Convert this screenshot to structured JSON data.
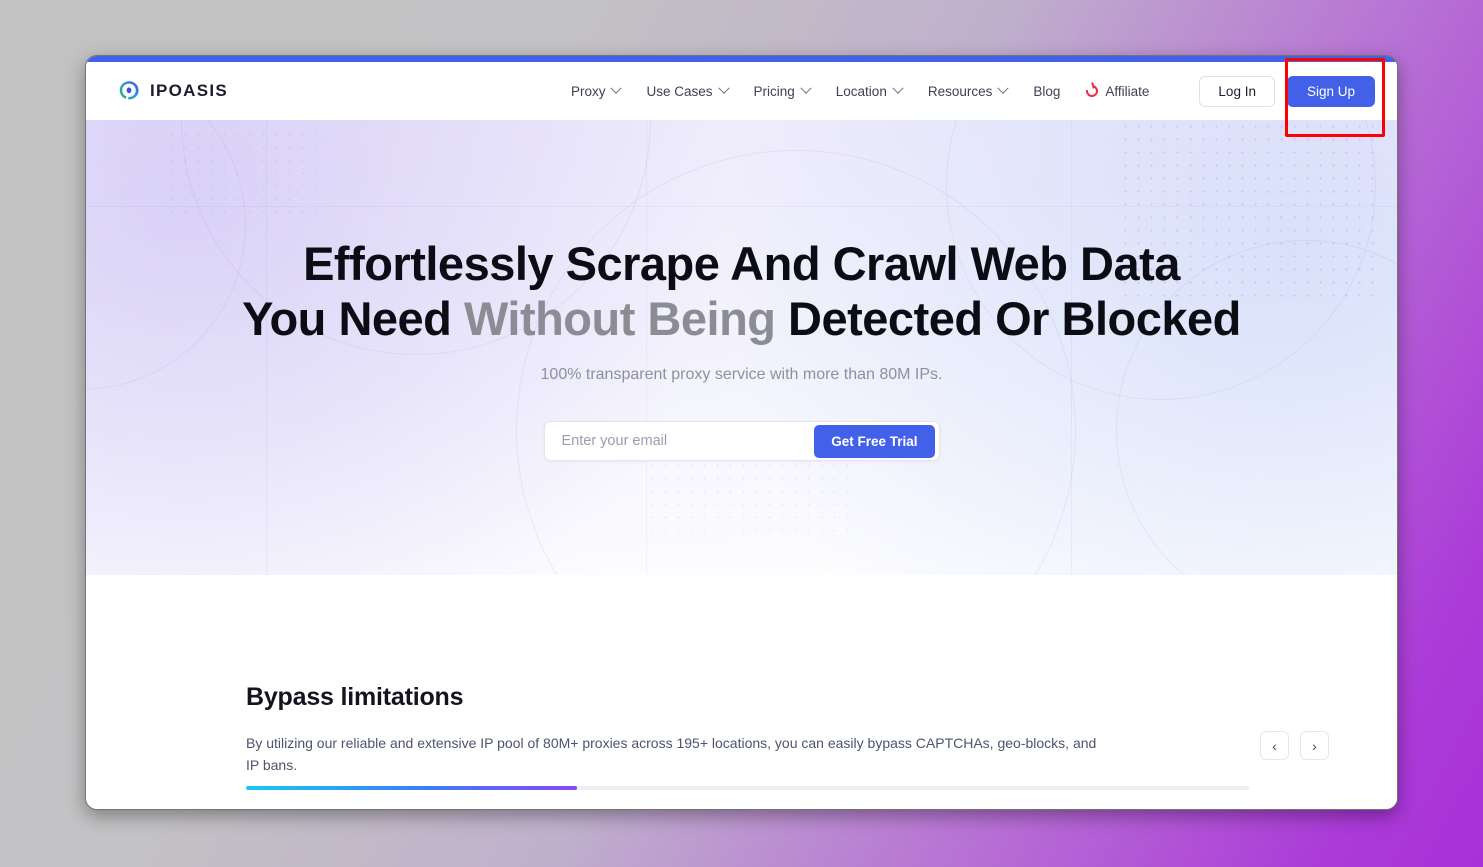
{
  "header": {
    "brand": {
      "name": "IPOASIS",
      "icon": "droplet-logo-icon"
    },
    "nav": [
      {
        "label": "Proxy",
        "has_caret": true
      },
      {
        "label": "Use Cases",
        "has_caret": true
      },
      {
        "label": "Pricing",
        "has_caret": true
      },
      {
        "label": "Location",
        "has_caret": true
      },
      {
        "label": "Resources",
        "has_caret": true
      },
      {
        "label": "Blog",
        "has_caret": false
      },
      {
        "label": "Affiliate",
        "has_caret": false,
        "icon": "affiliate-icon"
      }
    ],
    "login_label": "Log In",
    "signup_label": "Sign Up"
  },
  "hero": {
    "title_part1": "Effortlessly Scrape And Crawl Web Data",
    "title_part2": "You Need ",
    "title_muted": "Without Being",
    "title_part3": " Detected Or Blocked",
    "subtitle": "100% transparent proxy service with more than 80M IPs.",
    "email_placeholder": "Enter your email",
    "email_value": "",
    "cta_label": "Get Free Trial"
  },
  "features": {
    "title": "Bypass limitations",
    "description": "By utilizing our reliable and extensive IP pool of 80M+ proxies across 195+ locations, you can easily bypass CAPTCHAs, geo-blocks, and IP bans.",
    "prev_label": "‹",
    "next_label": "›",
    "progress_percent": 33
  },
  "colors": {
    "accent_blue": "#4361e8",
    "affiliate_red": "#f5273a",
    "highlight_red": "#fe0000",
    "progress_start": "#17c9f5",
    "progress_end": "#8b45f7"
  }
}
